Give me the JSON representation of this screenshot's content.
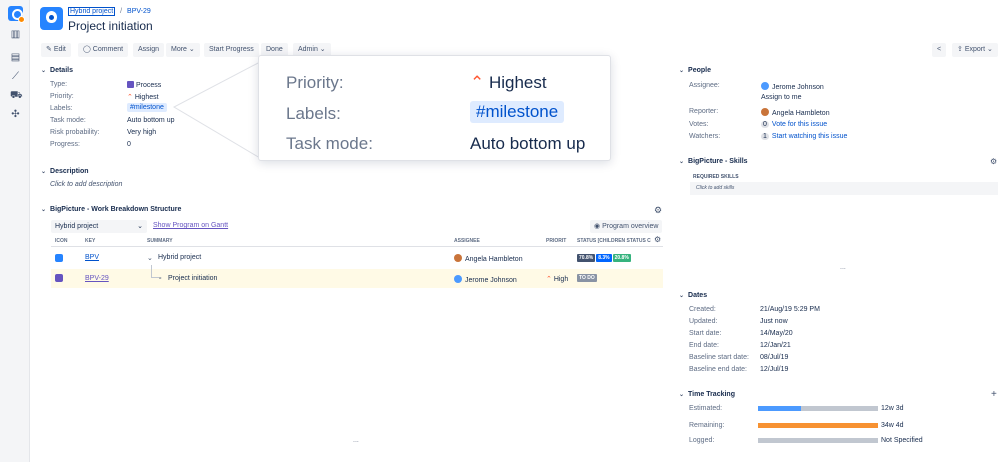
{
  "sidebar": {
    "icons": [
      "app-icon",
      "board-icon",
      "backlog-icon",
      "reports-icon",
      "releases-icon",
      "add-ons-icon"
    ]
  },
  "header": {
    "breadcrumb_project": "Hybrid project",
    "breadcrumb_sep": "/",
    "breadcrumb_issue": "BPV-29",
    "title": "Project initiation"
  },
  "toolbar": {
    "edit": "Edit",
    "comment": "Comment",
    "assign": "Assign",
    "more": "More",
    "start_progress": "Start Progress",
    "done": "Done",
    "admin": "Admin",
    "export": "Export"
  },
  "details": {
    "heading": "Details",
    "type_label": "Type:",
    "type_value": "Process",
    "priority_label": "Priority:",
    "priority_value": "Highest",
    "labels_label": "Labels:",
    "labels_value": "#milestone",
    "task_mode_label": "Task mode:",
    "task_mode_value": "Auto bottom up",
    "risk_label": "Risk probability:",
    "risk_value": "Very high",
    "progress_label": "Progress:",
    "progress_value": "0"
  },
  "zoom": {
    "priority_label": "Priority:",
    "priority_value": "Highest",
    "labels_label": "Labels:",
    "labels_value": "#milestone",
    "task_mode_label": "Task mode:",
    "task_mode_value": "Auto bottom up"
  },
  "description": {
    "heading": "Description",
    "placeholder": "Click to add description"
  },
  "wbs": {
    "heading": "BigPicture - Work Breakdown Structure",
    "program_select": "Hybrid project",
    "show_link": "Show Program on Gantt",
    "overview": "Program overview",
    "columns": [
      "ICON",
      "KEY",
      "SUMMARY",
      "ASSIGNEE",
      "PRIORIT",
      "STATUS [CHILDREN STATUS C"
    ],
    "rows": [
      {
        "key": "BPV",
        "summary": "Hybrid project",
        "assignee": "Angela Hambleton",
        "priority": "",
        "status": [
          "70.8%",
          "8.3%",
          "20.8%"
        ]
      },
      {
        "key": "BPV-29",
        "summary": "Project initiation",
        "assignee": "Jerome Johnson",
        "priority": "High",
        "status": [
          "TO DO"
        ]
      }
    ],
    "more": "..."
  },
  "people": {
    "heading": "People",
    "assignee_label": "Assignee:",
    "assignee": "Jerome Johnson",
    "assign_me": "Assign to me",
    "reporter_label": "Reporter:",
    "reporter": "Angela Hambleton",
    "votes_label": "Votes:",
    "votes_count": "0",
    "vote_link": "Vote for this issue",
    "watchers_label": "Watchers:",
    "watchers_count": "1",
    "watch_link": "Start watching this issue"
  },
  "skills": {
    "heading": "BigPicture - Skills",
    "required": "REQUIRED SKILLS",
    "add": "Click to add skills",
    "more": "..."
  },
  "dates": {
    "heading": "Dates",
    "created_label": "Created:",
    "created": "21/Aug/19 5:29 PM",
    "updated_label": "Updated:",
    "updated": "Just now",
    "start_label": "Start date:",
    "start": "14/May/20",
    "end_label": "End date:",
    "end": "12/Jan/21",
    "bstart_label": "Baseline start date:",
    "bstart": "08/Jul/19",
    "bend_label": "Baseline end date:",
    "bend": "12/Jul/19"
  },
  "time_tracking": {
    "heading": "Time Tracking",
    "add": "+",
    "estimated_label": "Estimated:",
    "estimated": "12w 3d",
    "estimated_fraction": 0.36,
    "remaining_label": "Remaining:",
    "remaining": "34w 4d",
    "remaining_fraction": 1.0,
    "logged_label": "Logged:",
    "logged": "Not Specified",
    "logged_fraction": 0
  },
  "bottom_more": "...",
  "colors": {
    "accent": "#0052cc",
    "priority": "#ff5630",
    "estimated": "#4c9aff",
    "remaining": "#f79232",
    "status_done": "#36b37e",
    "status_inprogress": "#0065ff",
    "status_todo": "#42526e"
  }
}
